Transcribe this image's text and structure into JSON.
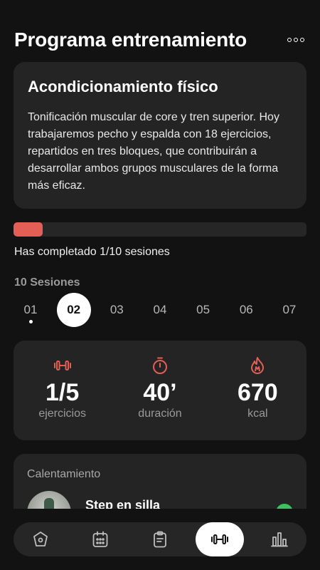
{
  "header": {
    "title": "Programa entrenamiento",
    "more_icon": "more-icon"
  },
  "description": {
    "title": "Acondicionamiento físico",
    "text": "Tonificación muscular de core y tren superior. Hoy trabajaremos pecho y espalda con 18 ejercicios, repartidos en tres bloques, que contribuirán a desarrollar ambos grupos musculares de la forma más eficaz."
  },
  "progress": {
    "completed": 1,
    "total": 10,
    "text": "Has completado 1/10 sesiones",
    "color": "#e35e55"
  },
  "sessions": {
    "label": "10 Sesiones",
    "items": [
      {
        "label": "01",
        "active": false,
        "done": true
      },
      {
        "label": "02",
        "active": true,
        "done": false
      },
      {
        "label": "03",
        "active": false,
        "done": false
      },
      {
        "label": "04",
        "active": false,
        "done": false
      },
      {
        "label": "05",
        "active": false,
        "done": false
      },
      {
        "label": "06",
        "active": false,
        "done": false
      },
      {
        "label": "07",
        "active": false,
        "done": false
      }
    ]
  },
  "stats": [
    {
      "icon": "dumbbell-icon",
      "value": "1/5",
      "label": "ejercicios"
    },
    {
      "icon": "stopwatch-icon",
      "value": "40’",
      "label": "duración"
    },
    {
      "icon": "flame-icon",
      "value": "670",
      "label": "kcal"
    }
  ],
  "warmup": {
    "title": "Calentamiento",
    "exercise": {
      "name": "Step en silla",
      "status_color": "#3fbf5f"
    }
  },
  "accent_color": "#e35e55",
  "bottom_nav": [
    {
      "name": "home",
      "icon": "home-icon",
      "active": false
    },
    {
      "name": "calendar",
      "icon": "calendar-icon",
      "active": false
    },
    {
      "name": "clipboard",
      "icon": "clipboard-icon",
      "active": false
    },
    {
      "name": "workout",
      "icon": "dumbbell-icon",
      "active": true
    },
    {
      "name": "stats",
      "icon": "bar-chart-icon",
      "active": false
    }
  ]
}
